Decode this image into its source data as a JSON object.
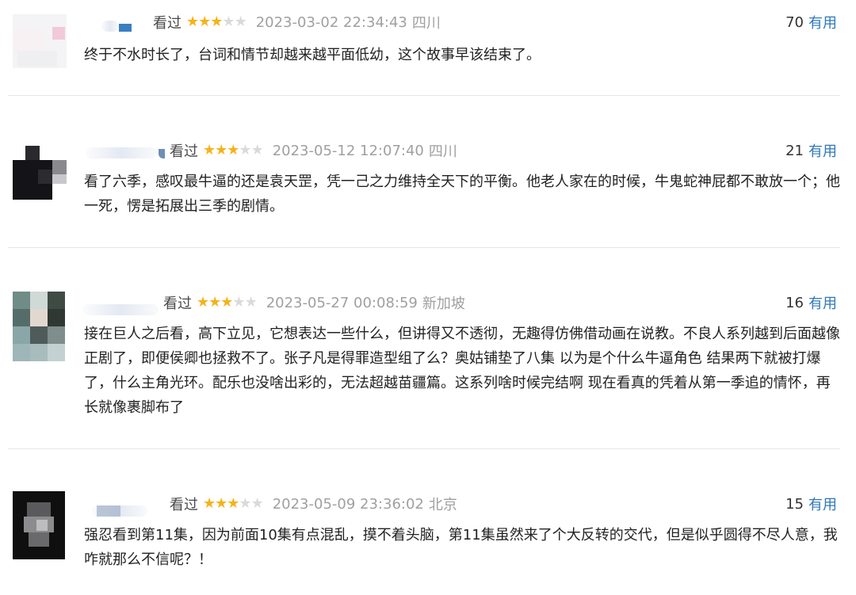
{
  "comments": [
    {
      "status": "看过",
      "rating": 3,
      "date": "2023-03-02 22:34:43",
      "location": "四川",
      "votes": "70",
      "useful_label": "有用",
      "text": "终于不水时长了，台词和情节却越来越平面低幼，这个故事早该结束了。"
    },
    {
      "status": "看过",
      "rating": 3,
      "date": "2023-05-12 12:07:40",
      "location": "四川",
      "votes": "21",
      "useful_label": "有用",
      "text": "看了六季，感叹最牛逼的还是袁天罡，凭一己之力维持全天下的平衡。他老人家在的时候，牛鬼蛇神屁都不敢放一个；他一死，愣是拓展出三季的剧情。"
    },
    {
      "status": "看过",
      "rating": 3,
      "date": "2023-05-27 00:08:59",
      "location": "新加坡",
      "votes": "16",
      "useful_label": "有用",
      "text": "接在巨人之后看，高下立见，它想表达一些什么，但讲得又不透彻，无趣得仿佛借动画在说教。不良人系列越到后面越像正剧了，即便侯卿也拯救不了。张子凡是得罪造型组了么？奥姑铺垫了八集 以为是个什么牛逼角色 结果两下就被打爆了，什么主角光环。配乐也没啥出彩的，无法超越苗疆篇。这系列啥时候完结啊 现在看真的凭着从第一季追的情怀，再长就像裹脚布了"
    },
    {
      "status": "看过",
      "rating": 3,
      "date": "2023-05-09 23:36:02",
      "location": "北京",
      "votes": "15",
      "useful_label": "有用",
      "text": "强忍看到第11集，因为前面10集有点混乱，摸不着头脑，第11集虽然来了个大反转的交代，但是似乎圆得不尽人意，我咋就那么不信呢？！"
    }
  ],
  "colors": {
    "star_on": "#f5b21a",
    "star_off": "#dadada",
    "useful_link": "#2f78b9",
    "meta_gray": "#a0a0a0"
  },
  "icons": {
    "star": "star-icon",
    "avatar": "pixelated-avatar"
  }
}
